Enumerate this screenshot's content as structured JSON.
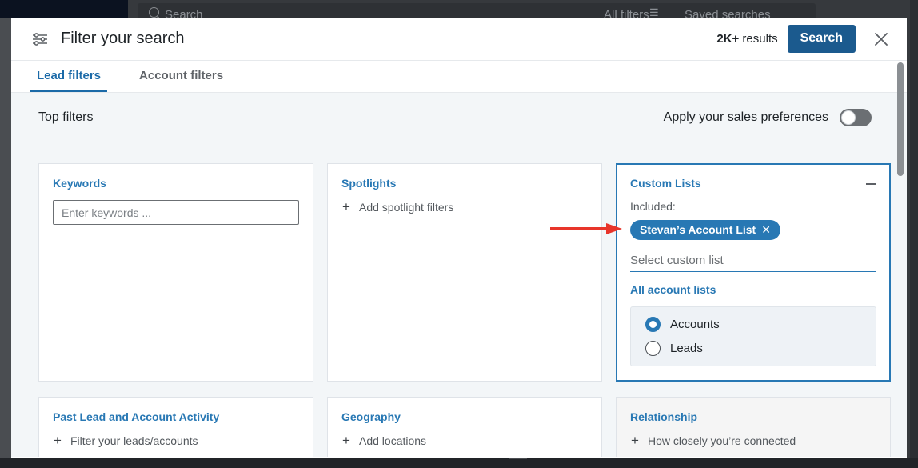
{
  "background_app": {
    "search_placeholder": "Search",
    "all_filters_label": "All filters",
    "saved_searches_label": "Saved searches"
  },
  "header": {
    "icon": "sliders-filter-icon",
    "title": "Filter your search",
    "results_count_value": "2K+",
    "results_count_suffix": " results",
    "search_button_label": "Search",
    "close_icon": "close-icon"
  },
  "tabs": [
    {
      "label": "Lead filters",
      "active": true
    },
    {
      "label": "Account filters",
      "active": false
    }
  ],
  "body": {
    "section_label": "Top filters",
    "preferences_label": "Apply your sales preferences",
    "preferences_toggle_state": "off"
  },
  "cards": {
    "keywords": {
      "title": "Keywords",
      "input_placeholder": "Enter keywords ...",
      "input_value": ""
    },
    "spotlights": {
      "title": "Spotlights",
      "action_label": "Add spotlight filters",
      "action_icon": "plus-icon"
    },
    "custom_lists": {
      "title": "Custom Lists",
      "collapse_icon": "minus-icon",
      "included_label": "Included:",
      "pill_label": "Stevan’s Account List",
      "pill_remove_icon": "close-icon",
      "select_placeholder": "Select custom list",
      "link_label": "All account lists",
      "radios": [
        {
          "label": "Accounts",
          "checked": true
        },
        {
          "label": "Leads",
          "checked": false
        }
      ]
    },
    "past_activity": {
      "title": "Past Lead and Account Activity",
      "action_label": "Filter your leads/accounts",
      "action_icon": "plus-icon"
    },
    "geography": {
      "title": "Geography",
      "action_label": "Add locations",
      "action_icon": "plus-icon"
    },
    "relationship": {
      "title": "Relationship",
      "action_label": "How closely you’re connected",
      "action_icon": "plus-icon"
    }
  },
  "annotation": {
    "type": "red-arrow",
    "points_to": "custom-lists-pill",
    "color": "#e8352a"
  },
  "colors": {
    "accent_blue": "#2878b4",
    "search_button_blue": "#1b5a8e",
    "body_background": "#f3f6f8",
    "card_background": "#ffffff",
    "annotation_red": "#e8352a"
  }
}
